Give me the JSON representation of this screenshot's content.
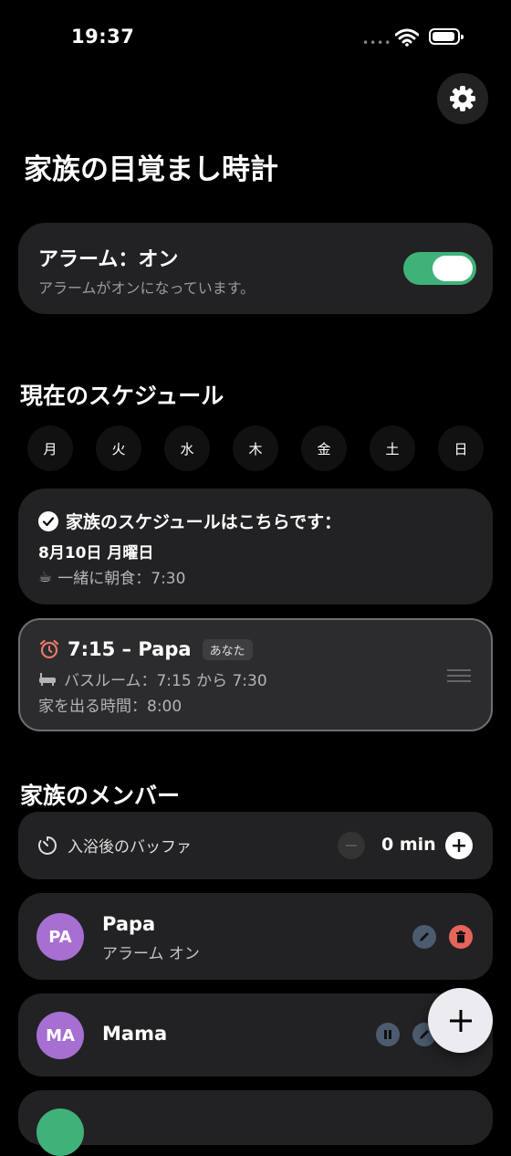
{
  "status_bar": {
    "time": "19:37"
  },
  "app": {
    "title": "家族の目覚まし時計"
  },
  "alarm": {
    "title": "アラーム：オン",
    "subtitle": "アラームがオンになっています。",
    "enabled": true,
    "toggle_color": "#3fb27a"
  },
  "schedule": {
    "section_title": "現在のスケジュール",
    "days": [
      "月",
      "火",
      "水",
      "木",
      "金",
      "土",
      "日"
    ],
    "summary": {
      "heading": "家族のスケジュールはこちらです：",
      "date": "8月10日 月曜日",
      "meal_icon": "☕",
      "meal": "一緒に朝食：7:30"
    },
    "entry": {
      "time_name": "7:15 – Papa",
      "badge": "あなた",
      "bathroom": "バスルーム：7:15 から 7:30",
      "leave": "家を出る時間：8:00"
    }
  },
  "members": {
    "section_title": "家族のメンバー",
    "buffer": {
      "label": "入浴後のバッファ",
      "value": "0 min"
    },
    "list": [
      {
        "initials": "PA",
        "name": "Papa",
        "status": "アラーム オン",
        "avatar_color": "#a66fd1"
      },
      {
        "initials": "MA",
        "name": "Mama",
        "status": "",
        "avatar_color": "#a66fd1"
      }
    ]
  },
  "colors": {
    "accent_green": "#3fb27a",
    "delete_red": "#e5645c",
    "edit_blue": "#4c5b6f"
  }
}
